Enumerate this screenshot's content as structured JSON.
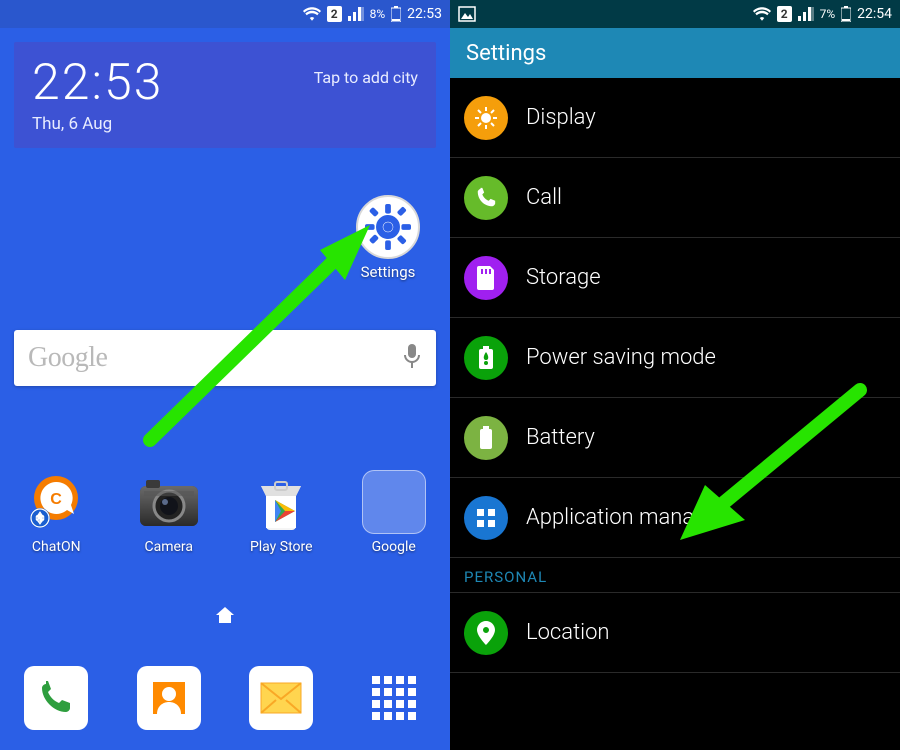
{
  "left": {
    "status": {
      "sim": "2",
      "battery_pct": "8%",
      "time": "22:53"
    },
    "clock": {
      "time": "22:53",
      "date": "Thu, 6 Aug",
      "add_city": "Tap to add city"
    },
    "settings_shortcut": "Settings",
    "search": {
      "logo": "Google"
    },
    "apps": [
      {
        "label": "ChatON"
      },
      {
        "label": "Camera"
      },
      {
        "label": "Play Store"
      },
      {
        "label": "Google"
      }
    ]
  },
  "right": {
    "status": {
      "sim": "2",
      "battery_pct": "7%",
      "time": "22:54"
    },
    "header": "Settings",
    "items": [
      {
        "label": "Display",
        "color": "#f59e0b",
        "icon": "display"
      },
      {
        "label": "Call",
        "color": "#66bb2a",
        "icon": "call"
      },
      {
        "label": "Storage",
        "color": "#a020f0",
        "icon": "storage"
      },
      {
        "label": "Power saving mode",
        "color": "#0aa20a",
        "icon": "power"
      },
      {
        "label": "Battery",
        "color": "#7cb342",
        "icon": "battery"
      },
      {
        "label": "Application manager",
        "color": "#1976d2",
        "icon": "apps"
      }
    ],
    "section": "PERSONAL",
    "items2": [
      {
        "label": "Location",
        "color": "#0aa20a",
        "icon": "location"
      }
    ]
  },
  "colors": {
    "home_bg": "#2b5fe6",
    "arrow": "#27e400"
  }
}
